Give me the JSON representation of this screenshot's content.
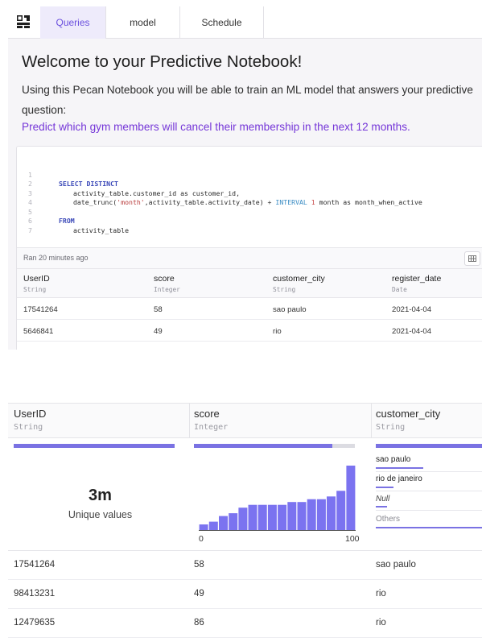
{
  "tabs": [
    "Queries",
    "model",
    "Schedule"
  ],
  "notebook": {
    "title": "Welcome to your Predictive Notebook!",
    "intro": "Using this Pecan Notebook you will be able to train an ML model that answers your predictive question:",
    "question": "Predict which gym members will cancel their membership in the next 12 months."
  },
  "query": {
    "line_numbers": [
      "1",
      "2",
      "3",
      "4",
      "5",
      "6",
      "7"
    ],
    "code": {
      "select": "SELECT DISTINCT",
      "line2": "activity_table.customer_id as customer_id,",
      "line3_fn": "date_trunc(",
      "line3_str": "'month'",
      "line3_mid": ",activity_table.activity_date) + ",
      "line3_kw": "INTERVAL",
      "line3_num": "1",
      "line3_end": " month as month_when_active",
      "from": "FROM",
      "line6": "activity_table"
    },
    "ran_label": "Ran 20 minutes ago"
  },
  "results_table": {
    "columns": [
      {
        "name": "UserID",
        "type": "String"
      },
      {
        "name": "score",
        "type": "Integer"
      },
      {
        "name": "customer_city",
        "type": "String"
      },
      {
        "name": "register_date",
        "type": "Date"
      }
    ],
    "rows": [
      [
        "17541264",
        "58",
        "sao paulo",
        "2021-04-04"
      ],
      [
        "5646841",
        "49",
        "rio",
        "2021-04-04"
      ]
    ]
  },
  "profile_table": {
    "columns": [
      {
        "name": "UserID",
        "type": "String"
      },
      {
        "name": "score",
        "type": "Integer"
      },
      {
        "name": "customer_city",
        "type": "String"
      }
    ],
    "userid_summary": {
      "value": "3m",
      "label": "Unique values",
      "fill": 1.0
    },
    "score_summary": {
      "fill": 0.86
    },
    "city_summary": {
      "fill": 1.0,
      "items": [
        {
          "label": "sao paulo",
          "share": 0.42
        },
        {
          "label": "rio de janeiro",
          "share": 0.16
        },
        {
          "label": "Null",
          "share": 0.1
        },
        {
          "label": "Others",
          "share": 1.0
        }
      ]
    },
    "rows": [
      [
        "17541264",
        "58",
        "sao paulo"
      ],
      [
        "98413231",
        "49",
        "rio"
      ],
      [
        "12479635",
        "86",
        "rio"
      ]
    ]
  },
  "chart_data": {
    "type": "bar",
    "title": "",
    "xlabel": "",
    "ylabel": "",
    "xlim": [
      0,
      100
    ],
    "x_ticks": [
      "0",
      "100"
    ],
    "values": [
      2,
      3,
      5,
      6,
      8,
      9,
      9,
      9,
      9,
      10,
      10,
      11,
      11,
      12,
      14,
      23
    ],
    "color": "#7b73f0"
  }
}
